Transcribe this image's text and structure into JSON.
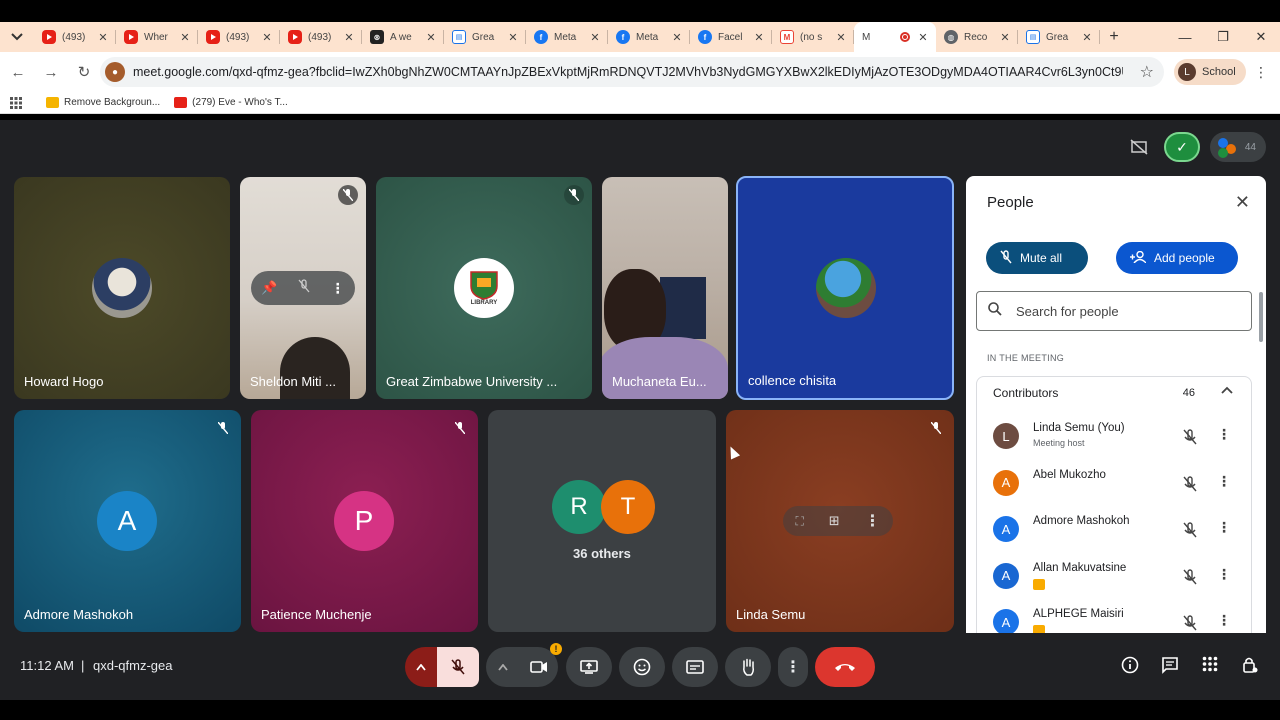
{
  "browser": {
    "tabs": [
      {
        "favicon": "youtube-icon",
        "title": "(493)"
      },
      {
        "favicon": "youtube-icon",
        "title": "Wher"
      },
      {
        "favicon": "youtube-icon",
        "title": "(493)"
      },
      {
        "favicon": "youtube-icon",
        "title": "(493)"
      },
      {
        "favicon": "ai-icon",
        "title": "A we"
      },
      {
        "favicon": "doc-icon",
        "title": "Grea"
      },
      {
        "favicon": "facebook-icon",
        "title": "Meta"
      },
      {
        "favicon": "facebook-icon",
        "title": "Meta"
      },
      {
        "favicon": "facebook-icon",
        "title": "Facel"
      },
      {
        "favicon": "gmail-icon",
        "title": "(no s"
      },
      {
        "favicon": "meet-icon",
        "title": "M",
        "active": true
      },
      {
        "favicon": "globe-icon",
        "title": "Reco"
      },
      {
        "favicon": "doc-icon",
        "title": "Grea"
      }
    ],
    "url": "meet.google.com/qxd-qfmz-gea?fbclid=IwZXh0bgNhZW0CMTAAYnJpZBExVkptMjRmRDNQVTJ2MVhVb3NydGMGYXBwX2lkEDIyMjAzOTE3ODgyMDA4OTIAAR4Cvr6L3yn0Ct9UHs0gJfvP5aWvJp...",
    "profile_initial": "L",
    "profile_label": "School",
    "bookmarks": [
      {
        "label": "Remove Backgroun...",
        "color": "#f5b400"
      },
      {
        "label": "(279) Eve - Who's T...",
        "color": "#e62117"
      }
    ]
  },
  "meet": {
    "top_people_count": "44",
    "tiles": [
      {
        "name": "Howard Hogo"
      },
      {
        "name": "Sheldon Miti ..."
      },
      {
        "name": "Great Zimbabwe University ..."
      },
      {
        "name": "Muchaneta Eu..."
      },
      {
        "name": "collence chisita"
      },
      {
        "name": "Admore Mashokoh",
        "initial": "A"
      },
      {
        "name": "Patience Muchenje",
        "initial": "P"
      },
      {
        "name": "Linda Semu"
      }
    ],
    "others": {
      "initials": [
        "R",
        "T"
      ],
      "label": "36 others"
    },
    "logo_text": "LIBRARY"
  },
  "panel": {
    "title": "People",
    "mute_all": "Mute all",
    "add_people": "Add people",
    "search_placeholder": "Search for people",
    "section_label": "IN THE MEETING",
    "contributors_label": "Contributors",
    "contributors_count": "46",
    "people": [
      {
        "initial": "L",
        "name": "Linda Semu (You)",
        "sub": "Meeting host",
        "color": "#6d4c41"
      },
      {
        "initial": "A",
        "name": "Abel Mukozho",
        "sub": "",
        "color": "#e8710a"
      },
      {
        "initial": "A",
        "name": "Admore Mashokoh",
        "sub": "",
        "color": "#1a73e8"
      },
      {
        "initial": "A",
        "name": "Allan Makuvatsine",
        "sub": "",
        "color": "#1967d2"
      },
      {
        "initial": "A",
        "name": "ALPHEGE Maisiri",
        "sub": "",
        "color": "#1a73e8"
      }
    ]
  },
  "bottom": {
    "time": "11:12 AM",
    "separator": "|",
    "meeting_code": "qxd-qfmz-gea"
  }
}
